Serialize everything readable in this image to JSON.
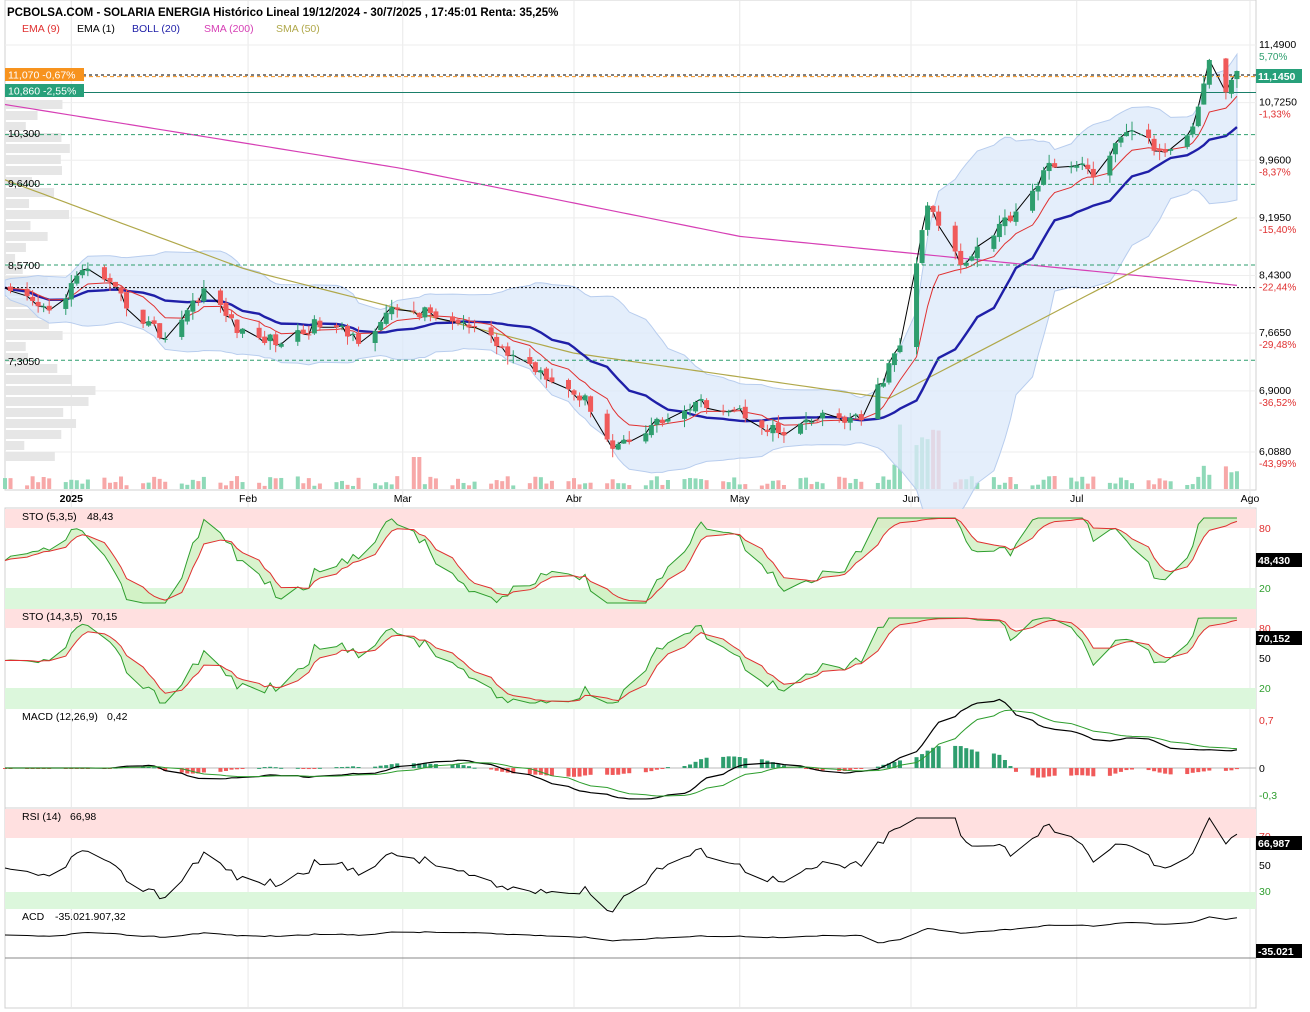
{
  "header": {
    "title": "PCBOLSA.COM - SOLARIA ENERGIA Histórico Lineal 19/12/2024 - 30/7/2025 , 17:45:01 Renta: 35,25%",
    "indicators": [
      {
        "label": "EMA (9)",
        "color": "#e03030"
      },
      {
        "label": "EMA (1)",
        "color": "#000000"
      },
      {
        "label": "BOLL (20)",
        "color": "#1f1fa8"
      },
      {
        "label": "SMA (200)",
        "color": "#d63fb5"
      },
      {
        "label": "SMA (50)",
        "color": "#b0a84a"
      }
    ]
  },
  "colors": {
    "up": "#2e9e6e",
    "down": "#f05a5a",
    "boll_band": "#dbe8fa",
    "boll_mid": "#1f1fa8",
    "sma200": "#d63fb5",
    "sma50": "#b0a84a",
    "overbought": "#ffe0e0",
    "oversold": "#dcf7dc"
  },
  "price_panel": {
    "y_axis": {
      "ticks": [
        "11,4900",
        "10,7250",
        "9,9600",
        "9,1950",
        "8,4300",
        "7,6650",
        "6,9000",
        "6,0880"
      ],
      "pct_ticks": [
        "5,70%",
        "-1,33%",
        "-8,37%",
        "-15,40%",
        "-22,44%",
        "-29,48%",
        "-36,52%",
        "-43,99%"
      ],
      "last_value": "11,1450"
    },
    "levels": [
      {
        "label": "11,070  -0,67%",
        "value": 11.07,
        "style": "orange"
      },
      {
        "label": "10,860  -2,55%",
        "value": 10.86,
        "style": "teal"
      },
      {
        "label": "10,300",
        "value": 10.3,
        "style": "dashed"
      },
      {
        "label": "9,6400",
        "value": 9.64,
        "style": "dashed"
      },
      {
        "label": "8,5700",
        "value": 8.57,
        "style": "dashed"
      },
      {
        "label": "7,3050",
        "value": 7.305,
        "style": "dashed"
      }
    ],
    "x_labels": [
      "2025",
      "Feb",
      "Mar",
      "Abr",
      "May",
      "Jun",
      "Jul",
      "Ago"
    ]
  },
  "indicator_panels": [
    {
      "label": "STO (5,3,5)",
      "value": "48,43",
      "last_value": "48,430",
      "ticks": [
        "80",
        "20"
      ]
    },
    {
      "label": "STO (14,3,5)",
      "value": "70,15",
      "last_value": "70,152",
      "ticks": [
        "80",
        "50",
        "20"
      ]
    },
    {
      "label": "MACD (12,26,9)",
      "value": "0,42",
      "ticks": [
        "0,7",
        "0",
        "-0,3"
      ]
    },
    {
      "label": "RSI (14)",
      "value": "66,98",
      "last_value": "66,987",
      "ticks": [
        "70",
        "50",
        "30"
      ]
    },
    {
      "label": "ACD",
      "value": "-35.021.907,32",
      "last_value": "-35.021"
    }
  ],
  "chart_data": {
    "type": "candlestick",
    "title": "PCBOLSA.COM - SOLARIA ENERGIA Histórico Lineal 19/12/2024 - 30/7/2025",
    "ylim": [
      6.0,
      11.75
    ],
    "close_keypoints": [
      {
        "date": "2024-12-19",
        "close": 8.2
      },
      {
        "date": "2024-12-27",
        "close": 7.95
      },
      {
        "date": "2025-01-03",
        "close": 8.55
      },
      {
        "date": "2025-01-10",
        "close": 8.05
      },
      {
        "date": "2025-01-17",
        "close": 7.6
      },
      {
        "date": "2025-01-24",
        "close": 8.25
      },
      {
        "date": "2025-01-31",
        "close": 7.65
      },
      {
        "date": "2025-02-07",
        "close": 7.55
      },
      {
        "date": "2025-02-14",
        "close": 7.8
      },
      {
        "date": "2025-02-21",
        "close": 7.6
      },
      {
        "date": "2025-02-28",
        "close": 8.0
      },
      {
        "date": "2025-03-07",
        "close": 7.9
      },
      {
        "date": "2025-03-14",
        "close": 7.7
      },
      {
        "date": "2025-03-21",
        "close": 7.35
      },
      {
        "date": "2025-03-28",
        "close": 7.1
      },
      {
        "date": "2025-04-04",
        "close": 6.7
      },
      {
        "date": "2025-04-08",
        "close": 6.15
      },
      {
        "date": "2025-04-15",
        "close": 6.45
      },
      {
        "date": "2025-04-25",
        "close": 6.75
      },
      {
        "date": "2025-05-02",
        "close": 6.6
      },
      {
        "date": "2025-05-09",
        "close": 6.3
      },
      {
        "date": "2025-05-16",
        "close": 6.55
      },
      {
        "date": "2025-05-23",
        "close": 6.5
      },
      {
        "date": "2025-05-30",
        "close": 7.5
      },
      {
        "date": "2025-06-04",
        "close": 9.35
      },
      {
        "date": "2025-06-10",
        "close": 8.6
      },
      {
        "date": "2025-06-20",
        "close": 9.3
      },
      {
        "date": "2025-06-27",
        "close": 9.95
      },
      {
        "date": "2025-07-04",
        "close": 9.8
      },
      {
        "date": "2025-07-11",
        "close": 10.4
      },
      {
        "date": "2025-07-17",
        "close": 10.0
      },
      {
        "date": "2025-07-22",
        "close": 10.45
      },
      {
        "date": "2025-07-25",
        "close": 11.3
      },
      {
        "date": "2025-07-28",
        "close": 10.9
      },
      {
        "date": "2025-07-30",
        "close": 11.145
      }
    ],
    "sma200_keypoints": [
      [
        "2024-12-19",
        10.7
      ],
      [
        "2025-03-01",
        9.85
      ],
      [
        "2025-05-01",
        8.95
      ],
      [
        "2025-07-30",
        8.3
      ]
    ],
    "sma50_keypoints": [
      [
        "2024-12-19",
        9.7
      ],
      [
        "2025-02-01",
        8.5
      ],
      [
        "2025-04-01",
        7.4
      ],
      [
        "2025-05-28",
        6.8
      ],
      [
        "2025-07-30",
        9.2
      ]
    ],
    "last_close": 11.145
  }
}
